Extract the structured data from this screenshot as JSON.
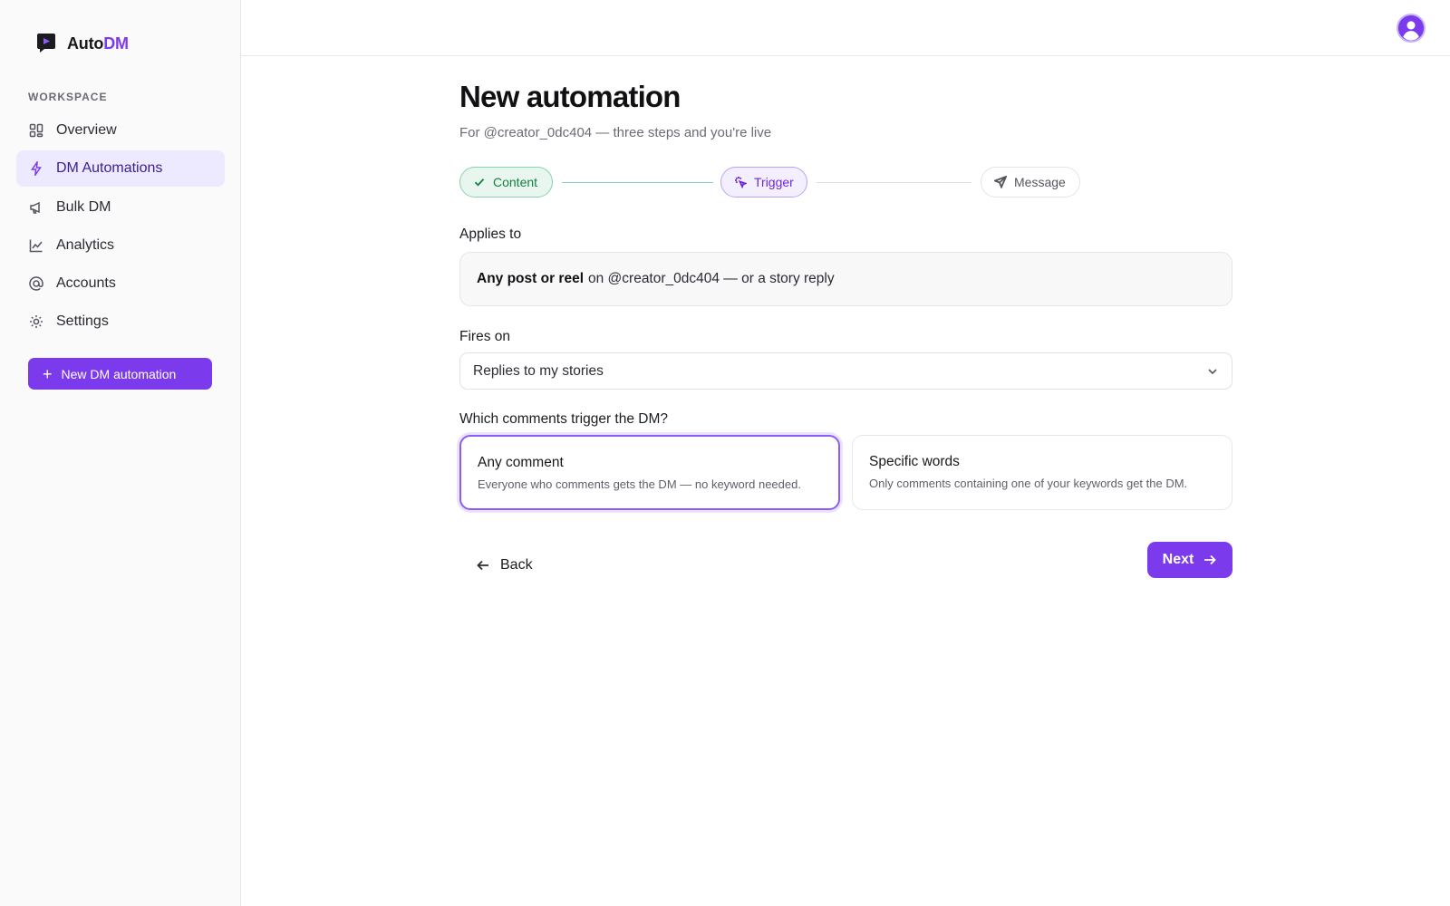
{
  "brand": {
    "name_prefix": "Auto",
    "name_accent": "DM",
    "logo_icon": "chat-bubble-play-icon"
  },
  "sidebar": {
    "section_label": "WORKSPACE",
    "items": [
      {
        "label": "Overview",
        "icon": "grid-icon",
        "active": false
      },
      {
        "label": "DM Automations",
        "icon": "lightning-icon",
        "active": true
      },
      {
        "label": "Bulk DM",
        "icon": "megaphone-icon",
        "active": false
      },
      {
        "label": "Analytics",
        "icon": "line-chart-icon",
        "active": false
      },
      {
        "label": "Accounts",
        "icon": "at-sign-icon",
        "active": false
      },
      {
        "label": "Settings",
        "icon": "sun-gear-icon",
        "active": false
      }
    ],
    "new_button_label": "New DM automation"
  },
  "topbar": {
    "avatar_icon": "user-avatar-icon"
  },
  "page": {
    "title": "New automation",
    "subtitle": "For @creator_0dc404 — three steps and you're live"
  },
  "stepper": {
    "steps": [
      {
        "label": "Content",
        "state": "done",
        "icon": "check-icon"
      },
      {
        "label": "Trigger",
        "state": "current",
        "icon": "sparkle-pointer-icon"
      },
      {
        "label": "Message",
        "state": "pending",
        "icon": "send-icon"
      }
    ]
  },
  "form": {
    "applies_label": "Applies to",
    "applies_bold": "Any post or reel",
    "applies_rest": "on @creator_0dc404 — or a story reply",
    "fires_label": "Fires on",
    "fires_value": "Replies to my stories",
    "which_label": "Which comments trigger the DM?",
    "choices": [
      {
        "title": "Any comment",
        "desc": "Everyone who comments gets the DM — no keyword needed.",
        "selected": true
      },
      {
        "title": "Specific words",
        "desc": "Only comments containing one of your keywords get the DM.",
        "selected": false
      }
    ]
  },
  "actions": {
    "back_label": "Back",
    "next_label": "Next"
  },
  "colors": {
    "accent": "#7c3aed",
    "success": "#15803d",
    "active_nav_bg": "#ede9fe"
  }
}
